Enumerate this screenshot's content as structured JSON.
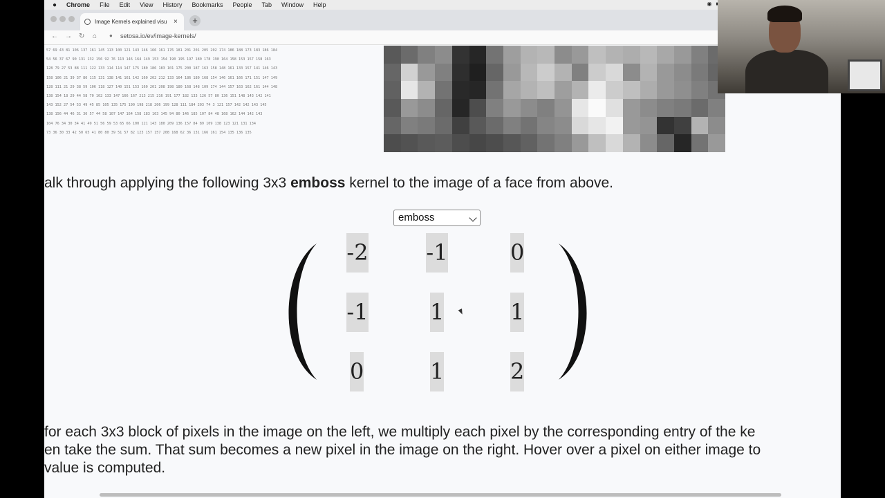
{
  "menubar": {
    "app": "Chrome",
    "items": [
      "File",
      "Edit",
      "View",
      "History",
      "Bookmarks",
      "People",
      "Tab",
      "Window",
      "Help"
    ]
  },
  "browser": {
    "tab_title": "Image Kernels explained visu",
    "tab_close": "×",
    "new_tab": "+",
    "url": "setosa.io/ev/image-kernels/"
  },
  "pixel_rows": [
    "57 69 43 81 106 137 161 145 113 100 121 143 146 166 161 176 181 201 201 205 202 174 186 188 173 183 186 184",
    "54 56 37 67 90 131 132 156 92 76 113 146 164 149 153 154 190 195 197 180 178 190 164 158 153 157 158 163",
    "128 79 27 53 88 111 122 133 114 114 147 175 180 186 183 101 175 200 187 163 158 148 161 133 157 141 146 143",
    "158 106 21 39 37 86 115 131 138 141 161 142 160 202 212 133 164 186 180 168 154 146 161 166 171 151 147 149",
    "128 111 21 29 38 59 106 118 127 140 151 153 160 201 208 198 180 168 148 109 174 144 157 163 162 161 144 148",
    "138 154 18 29 44 58 70 102 133 147 166 167 213 215 216 191 177 182 133 126 57 80 136 151 148 143 142 141",
    "143 152 27 54 53 49 45 85 105 135 175 190 198 218 206 199 128 111 184 203 74 3 121 157 142 142 143 145",
    "138 156 44 46 31 36 57 44 58 107 147 164 158 183 163 145 94 80 146 185 107 84 48 168 162 144 142 143",
    "104 76 34 30 34 41 49 51 56 59 53 65 66 100 121 143 180 209 136 157 84 89 109 138 123 121 131 134",
    "73 36 30 33 42 50 65 41 80 80 39 51 57 82 123 157 157 208 168 62 36 131 166 161 154 135 136 135"
  ],
  "pixel_image": {
    "levels": [
      [
        0.35,
        0.42,
        0.5,
        0.55,
        0.2,
        0.15,
        0.45,
        0.62,
        0.7,
        0.72,
        0.55,
        0.6,
        0.75,
        0.7,
        0.68,
        0.72,
        0.66,
        0.6,
        0.5,
        0.42
      ],
      [
        0.4,
        0.82,
        0.6,
        0.5,
        0.18,
        0.12,
        0.4,
        0.6,
        0.72,
        0.8,
        0.7,
        0.5,
        0.8,
        0.85,
        0.55,
        0.7,
        0.6,
        0.55,
        0.48,
        0.4
      ],
      [
        0.38,
        0.9,
        0.7,
        0.45,
        0.16,
        0.15,
        0.45,
        0.65,
        0.7,
        0.75,
        0.62,
        0.7,
        0.92,
        0.8,
        0.75,
        0.68,
        0.6,
        0.56,
        0.5,
        0.45
      ],
      [
        0.35,
        0.6,
        0.55,
        0.4,
        0.15,
        0.3,
        0.5,
        0.6,
        0.55,
        0.5,
        0.58,
        0.9,
        0.98,
        0.88,
        0.6,
        0.55,
        0.5,
        0.48,
        0.42,
        0.5
      ],
      [
        0.4,
        0.5,
        0.48,
        0.42,
        0.25,
        0.35,
        0.42,
        0.5,
        0.45,
        0.52,
        0.55,
        0.85,
        0.9,
        0.95,
        0.6,
        0.58,
        0.2,
        0.25,
        0.7,
        0.55
      ],
      [
        0.3,
        0.32,
        0.35,
        0.36,
        0.3,
        0.28,
        0.3,
        0.34,
        0.38,
        0.45,
        0.5,
        0.6,
        0.75,
        0.85,
        0.7,
        0.55,
        0.4,
        0.15,
        0.45,
        0.6
      ]
    ]
  },
  "intro": {
    "before": "alk through applying the following 3x3 ",
    "bold": "emboss",
    "after": " kernel to the image of a face from above."
  },
  "kernel": {
    "selected": "emboss",
    "matrix": [
      [
        "-2",
        "-1",
        "0"
      ],
      [
        "-1",
        "1",
        "1"
      ],
      [
        "0",
        "1",
        "2"
      ]
    ]
  },
  "explain": {
    "line1": "for each 3x3 block of pixels in the image on the left, we multiply each pixel by the corresponding entry of the ke",
    "line2": "en take the sum. That sum becomes a new pixel in the image on the right. Hover over a pixel on either image to",
    "line3": "value is computed."
  }
}
